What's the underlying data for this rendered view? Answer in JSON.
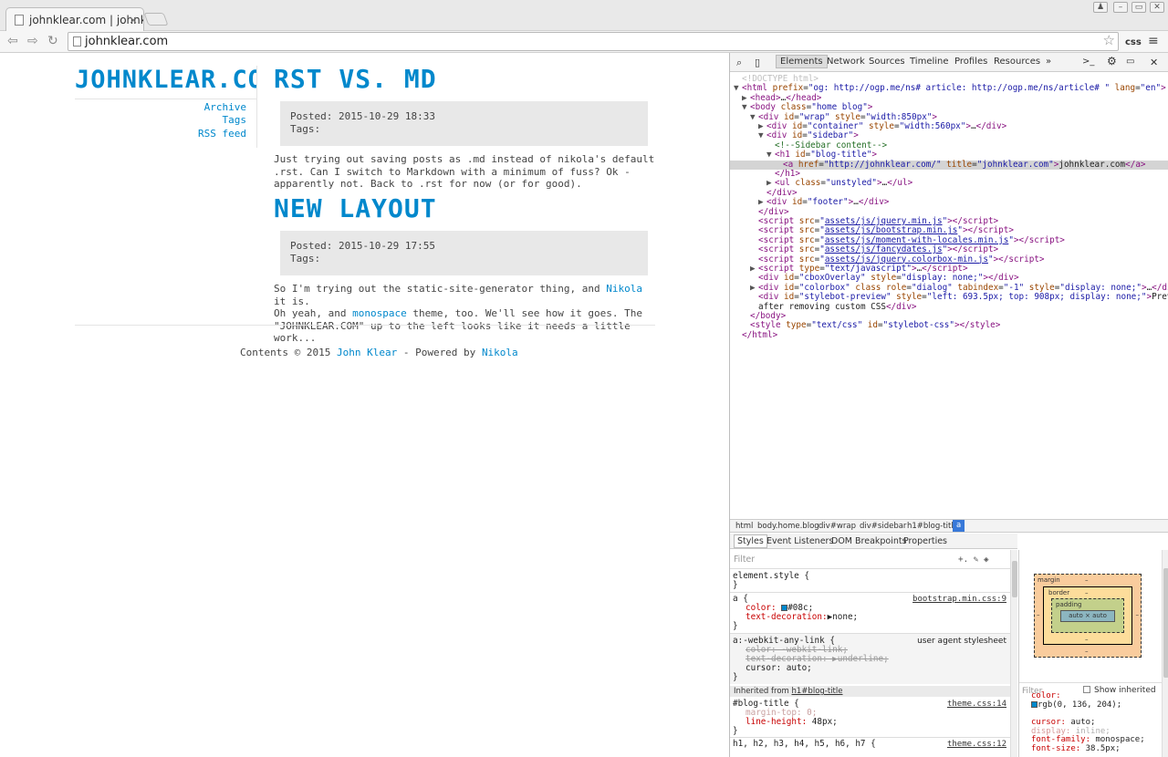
{
  "browser": {
    "tab_title": "johnklear.com | johnkl",
    "tab_close": "×",
    "url": "johnklear.com",
    "toolbar_css_label": "css",
    "win_buttons": [
      "♟",
      "–",
      "▭",
      "✕"
    ]
  },
  "page": {
    "site_title": "JOHNKLEAR.COM",
    "nav": [
      "Archive",
      "Tags",
      "RSS feed"
    ],
    "posts": [
      {
        "title": "RST VS. MD",
        "posted": "Posted: 2015-10-29 18:33",
        "tags": "Tags:",
        "body": "Just trying out saving posts as .md instead of nikola's default .rst. Can I switch to Markdown with a minimum of fuss? Ok - apparently not. Back to .rst for now (or for good)."
      },
      {
        "title": "NEW LAYOUT",
        "posted": "Posted: 2015-10-29 17:55",
        "tags": "Tags:",
        "body_1": "So I'm trying out the static-site-generator thing, and",
        "link_1": "Nikola",
        "body_2": "it is.",
        "body_3": "Oh yeah, and",
        "link_2": "monospace",
        "body_4": "theme, too. We'll see how it goes. The",
        "body_5": "\"JOHNKLEAR.COM\" up to the left looks like it needs a little work..."
      }
    ],
    "footer": {
      "prefix": "Contents © 2015",
      "author": "John Klear",
      "middle": "- Powered by",
      "engine": "Nikola"
    }
  },
  "devtools": {
    "tabs": [
      "Elements",
      "Network",
      "Sources",
      "Timeline",
      "Profiles",
      "Resources",
      "»"
    ],
    "dom_lines": [
      {
        "indent": 0,
        "arrow": "",
        "html": "<span class='dt'>&lt;!DOCTYPE html&gt;</span>"
      },
      {
        "indent": 0,
        "arrow": "▼",
        "html": "<span class='tg'>&lt;html</span> <span class='at'>prefix</span>=<span class='av'>\"og: http://ogp.me/ns# article: http://ogp.me/ns/article# \"</span> <span class='at'>lang</span>=<span class='av'>\"en\"</span><span class='tg'>&gt;</span>"
      },
      {
        "indent": 1,
        "arrow": "▶",
        "html": "<span class='tg'>&lt;head&gt;</span>…<span class='tg'>&lt;/head&gt;</span>"
      },
      {
        "indent": 1,
        "arrow": "▼",
        "html": "<span class='tg'>&lt;body</span> <span class='at'>class</span>=<span class='av'>\"home blog\"</span><span class='tg'>&gt;</span>"
      },
      {
        "indent": 2,
        "arrow": "▼",
        "html": "<span class='tg'>&lt;div</span> <span class='at'>id</span>=<span class='av'>\"wrap\"</span> <span class='at'>style</span>=<span class='av'>\"width:850px\"</span><span class='tg'>&gt;</span>"
      },
      {
        "indent": 3,
        "arrow": "▶",
        "html": "<span class='tg'>&lt;div</span> <span class='at'>id</span>=<span class='av'>\"container\"</span> <span class='at'>style</span>=<span class='av'>\"width:560px\"</span><span class='tg'>&gt;</span>…<span class='tg'>&lt;/div&gt;</span>"
      },
      {
        "indent": 3,
        "arrow": "▼",
        "html": "<span class='tg'>&lt;div</span> <span class='at'>id</span>=<span class='av'>\"sidebar\"</span><span class='tg'>&gt;</span>"
      },
      {
        "indent": 4,
        "arrow": "",
        "html": "<span class='cm'>&lt;!--Sidebar content--&gt;</span>"
      },
      {
        "indent": 4,
        "arrow": "▼",
        "html": "<span class='tg'>&lt;h1</span> <span class='at'>id</span>=<span class='av'>\"blog-title\"</span><span class='tg'>&gt;</span>"
      },
      {
        "indent": 5,
        "arrow": "",
        "html": "<span class='tg'>&lt;a</span> <span class='at'>href</span>=<span class='av'>\"http://johnklear.com/\"</span> <span class='at'>title</span>=<span class='av'>\"johnklear.com\"</span><span class='tg'>&gt;</span>johnklear.com<span class='tg'>&lt;/a&gt;</span>",
        "selected": true
      },
      {
        "indent": 4,
        "arrow": "",
        "html": "<span class='tg'>&lt;/h1&gt;</span>"
      },
      {
        "indent": 4,
        "arrow": "▶",
        "html": "<span class='tg'>&lt;ul</span> <span class='at'>class</span>=<span class='av'>\"unstyled\"</span><span class='tg'>&gt;</span>…<span class='tg'>&lt;/ul&gt;</span>"
      },
      {
        "indent": 3,
        "arrow": "",
        "html": "<span class='tg'>&lt;/div&gt;</span>"
      },
      {
        "indent": 3,
        "arrow": "▶",
        "html": "<span class='tg'>&lt;div</span> <span class='at'>id</span>=<span class='av'>\"footer\"</span><span class='tg'>&gt;</span>…<span class='tg'>&lt;/div&gt;</span>"
      },
      {
        "indent": 2,
        "arrow": "",
        "html": "<span class='tg'>&lt;/div&gt;</span>"
      },
      {
        "indent": 2,
        "arrow": "",
        "html": "<span class='tg'>&lt;script</span> <span class='at'>src</span>=<span class='av'>\"<span class='lk'>assets/js/jquery.min.js</span>\"</span><span class='tg'>&gt;&lt;/script&gt;</span>"
      },
      {
        "indent": 2,
        "arrow": "",
        "html": "<span class='tg'>&lt;script</span> <span class='at'>src</span>=<span class='av'>\"<span class='lk'>assets/js/bootstrap.min.js</span>\"</span><span class='tg'>&gt;&lt;/script&gt;</span>"
      },
      {
        "indent": 2,
        "arrow": "",
        "html": "<span class='tg'>&lt;script</span> <span class='at'>src</span>=<span class='av'>\"<span class='lk'>assets/js/moment-with-locales.min.js</span>\"</span><span class='tg'>&gt;&lt;/script&gt;</span>"
      },
      {
        "indent": 2,
        "arrow": "",
        "html": "<span class='tg'>&lt;script</span> <span class='at'>src</span>=<span class='av'>\"<span class='lk'>assets/js/fancydates.js</span>\"</span><span class='tg'>&gt;&lt;/script&gt;</span>"
      },
      {
        "indent": 2,
        "arrow": "",
        "html": "<span class='tg'>&lt;script</span> <span class='at'>src</span>=<span class='av'>\"<span class='lk'>assets/js/jquery.colorbox-min.js</span>\"</span><span class='tg'>&gt;&lt;/script&gt;</span>"
      },
      {
        "indent": 2,
        "arrow": "▶",
        "html": "<span class='tg'>&lt;script</span> <span class='at'>type</span>=<span class='av'>\"text/javascript\"</span><span class='tg'>&gt;</span>…<span class='tg'>&lt;/script&gt;</span>"
      },
      {
        "indent": 2,
        "arrow": "",
        "html": "<span class='tg'>&lt;div</span> <span class='at'>id</span>=<span class='av'>\"cboxOverlay\"</span> <span class='at'>style</span>=<span class='av'>\"display: none;\"</span><span class='tg'>&gt;&lt;/div&gt;</span>"
      },
      {
        "indent": 2,
        "arrow": "▶",
        "html": "<span class='tg'>&lt;div</span> <span class='at'>id</span>=<span class='av'>\"colorbox\"</span> <span class='at'>class role</span>=<span class='av'>\"dialog\"</span> <span class='at'>tabindex</span>=<span class='av'>\"-1\"</span> <span class='at'>style</span>=<span class='av'>\"display: none;\"</span><span class='tg'>&gt;</span>…<span class='tg'>&lt;/div&gt;</span>"
      },
      {
        "indent": 2,
        "arrow": "",
        "html": "<span class='tg'>&lt;div</span> <span class='at'>id</span>=<span class='av'>\"stylebot-preview\"</span> <span class='at'>style</span>=<span class='av'>\"left: 693.5px; top: 908px; display: none;\"</span><span class='tg'>&gt;</span>Preview"
      },
      {
        "indent": 2,
        "arrow": "",
        "html": "after removing custom CSS<span class='tg'>&lt;/div&gt;</span>"
      },
      {
        "indent": 1,
        "arrow": "",
        "html": "<span class='tg'>&lt;/body&gt;</span>"
      },
      {
        "indent": 1,
        "arrow": "",
        "html": "<span class='tg'>&lt;style</span> <span class='at'>type</span>=<span class='av'>\"text/css\"</span> <span class='at'>id</span>=<span class='av'>\"stylebot-css\"</span><span class='tg'>&gt;&lt;/style&gt;</span>"
      },
      {
        "indent": 0,
        "arrow": "",
        "html": "<span class='tg'>&lt;/html&gt;</span>"
      }
    ],
    "breadcrumbs": [
      "html",
      "body.home.blog",
      "div#wrap",
      "div#sidebar",
      "h1#blog-title",
      "a"
    ],
    "sub_tabs": [
      "Styles",
      "Event Listeners",
      "DOM Breakpoints",
      "Properties"
    ],
    "filter_placeholder": "Filter",
    "filter_icons": "+. ✎ ◈",
    "styles": {
      "element_style": "element.style {",
      "close": "}",
      "rule_a_selector": "a {",
      "rule_a_source": "bootstrap.min.css:9",
      "rule_a_color_prop": "color:",
      "rule_a_color_val": "#08c;",
      "rule_a_decor_prop": "text-decoration:",
      "rule_a_decor_val": "▶none;",
      "ua_selector": "a:-webkit-any-link {",
      "ua_source": "user agent stylesheet",
      "ua_color": "color: -webkit-link;",
      "ua_decor": "text-decoration: ▶underline;",
      "ua_cursor": "cursor: auto;",
      "inherited_prefix": "Inherited from",
      "inherited_link": "h1#blog-title",
      "blog_title_selector": "#blog-title {",
      "blog_title_source": "theme.css:14",
      "blog_title_margin": "margin-top: 0;",
      "blog_title_lh_prop": "line-height:",
      "blog_title_lh_val": "48px;",
      "h_selector": "h1, h2, h3, h4, h5, h6, h7 {",
      "h_source": "theme.css:12"
    },
    "boxmodel": {
      "margin": "margin",
      "border": "border",
      "padding": "padding",
      "dash": "–",
      "content": "auto × auto"
    },
    "computed": {
      "filter": "Filter",
      "show_inherited": "Show inherited",
      "lines": [
        {
          "prop": "color:",
          "val": "rgb(0, 136, 204);",
          "swatch": true
        },
        {
          "prop": "cursor:",
          "val": "auto;"
        },
        {
          "prop": "display:",
          "val": "inline;",
          "dim": true
        },
        {
          "prop": "font-family:",
          "val": "monospace;"
        },
        {
          "prop": "font-size:",
          "val": "38.5px;"
        }
      ]
    },
    "accent": "#3879d9",
    "link_color": "#0088cc"
  }
}
